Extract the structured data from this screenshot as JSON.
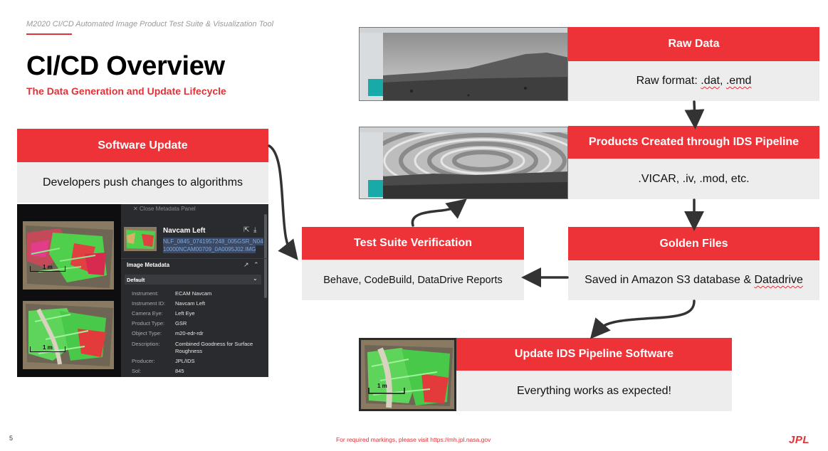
{
  "header": {
    "supertitle": "M2020 CI/CD Automated Image Product Test Suite & Visualization Tool",
    "title": "CI/CD Overview",
    "subtitle": "The Data Generation and Update Lifecycle"
  },
  "boxes": {
    "software_update": {
      "title": "Software Update",
      "body": "Developers push changes to algorithms"
    },
    "raw_data": {
      "title": "Raw Data",
      "body_prefix": "Raw format: ",
      "ext1": ".dat",
      "sep": ", ",
      "ext2": ".emd"
    },
    "products": {
      "title": "Products Created through IDS Pipeline",
      "body": ".VICAR, .iv, .mod, etc."
    },
    "test_suite": {
      "title": "Test Suite Verification",
      "body": "Behave, CodeBuild, DataDrive Reports"
    },
    "golden": {
      "title": "Golden Files",
      "body_prefix": "Saved in Amazon S3 database & ",
      "datadrive": "Datadrive"
    },
    "update_ids": {
      "title": "Update IDS Pipeline Software",
      "body": "Everything works as expected!"
    }
  },
  "metadata_panel": {
    "close_label": "Close Metadata Panel",
    "product_name": "Navcam Left",
    "filename_line1": "NLF_0845_0741957248_005GSR_N04",
    "filename_line2": "10000NCAM00709_0A0095J02.IMG",
    "section_title": "Image Metadata",
    "select_value": "Default",
    "rows": [
      {
        "label": "Instrument:",
        "value": "ECAM Navcam"
      },
      {
        "label": "Instrument ID:",
        "value": "Navcam Left"
      },
      {
        "label": "Camera Eye:",
        "value": "Left Eye"
      },
      {
        "label": "Product Type:",
        "value": "GSR"
      },
      {
        "label": "Object Type:",
        "value": "m20-edr-rdr"
      },
      {
        "label": "Description:",
        "value": "Combined Goodness for Surface"
      },
      {
        "label": "",
        "value": "Roughness"
      },
      {
        "label": "Producer:",
        "value": "JPL/IDS"
      },
      {
        "label": "Sol:",
        "value": "845"
      }
    ],
    "scale_label": "1 m"
  },
  "footer": {
    "page_number": "5",
    "note": "For required markings, please visit https://mh.jpl.nasa.gov",
    "logo": "JPL"
  },
  "colors": {
    "accent": "#ee3338",
    "body_bg": "#ededed",
    "arrow": "#333333"
  }
}
